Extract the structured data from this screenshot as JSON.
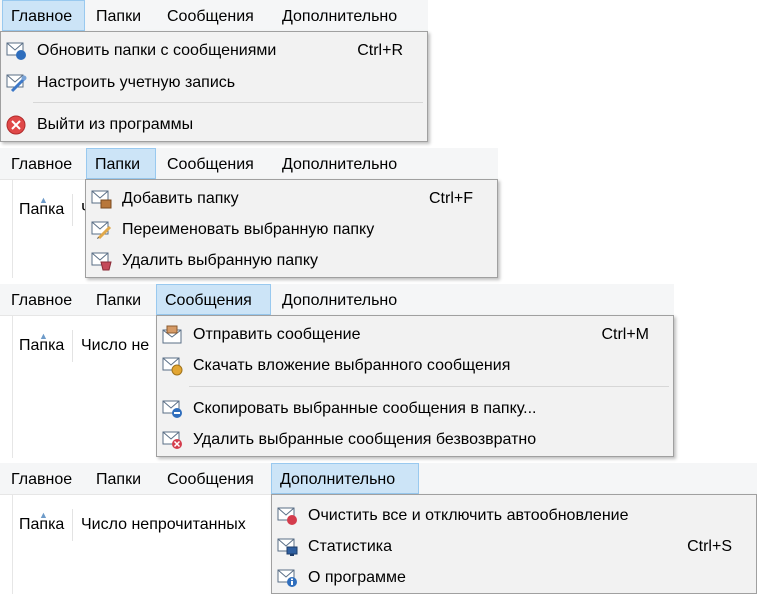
{
  "menu": {
    "main": "Главное",
    "folders": "Папки",
    "messages": "Сообщения",
    "extra": "Дополнительно"
  },
  "columns": {
    "folder": "Папка",
    "unread_cut1": "Ч",
    "unread_cut2": "Число не",
    "unread": "Число непрочитанных"
  },
  "main_menu": {
    "refresh": {
      "label": "Обновить папки с сообщениями",
      "shortcut": "Ctrl+R",
      "icon": "refresh-mail-icon"
    },
    "account": {
      "label": "Настроить учетную запись",
      "icon": "account-settings-icon"
    },
    "exit": {
      "label": "Выйти из программы",
      "icon": "exit-icon"
    }
  },
  "folders_menu": {
    "add": {
      "label": "Добавить папку",
      "shortcut": "Ctrl+F",
      "icon": "add-folder-icon"
    },
    "rename": {
      "label": "Переименовать выбранную папку",
      "icon": "rename-folder-icon"
    },
    "delete": {
      "label": "Удалить выбранную папку",
      "icon": "delete-folder-icon"
    }
  },
  "messages_menu": {
    "send": {
      "label": "Отправить сообщение",
      "shortcut": "Ctrl+M",
      "icon": "send-mail-icon"
    },
    "download": {
      "label": "Скачать вложение выбранного сообщения",
      "icon": "download-attachment-icon"
    },
    "copy": {
      "label": "Скопировать выбранные сообщения в папку...",
      "icon": "copy-mail-icon"
    },
    "delete": {
      "label": "Удалить выбранные сообщения безвозвратно",
      "icon": "delete-mail-icon"
    }
  },
  "extra_menu": {
    "clear": {
      "label": "Очистить все и отключить автообновление",
      "icon": "clear-mail-icon"
    },
    "stats": {
      "label": "Статистика",
      "shortcut": "Ctrl+S",
      "icon": "statistics-icon"
    },
    "about": {
      "label": "О программе",
      "icon": "about-icon"
    }
  },
  "colors": {
    "active_menu_bg": "#cce4f7",
    "active_menu_border": "#99c9ef",
    "dropdown_bg": "#f2f2f2"
  }
}
